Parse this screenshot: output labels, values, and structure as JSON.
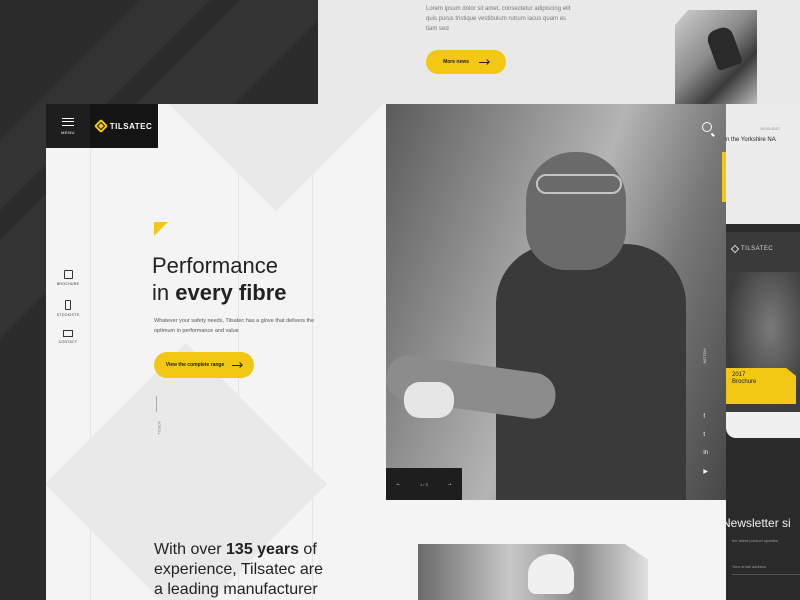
{
  "back_page": {
    "body_text": "Lorem ipsum dolor sit amet, consectetur adipiscing elit quis purus tristique vestibulum rutrum iacus quam es tiam sed",
    "button_label": "More news"
  },
  "side_news": {
    "date": "19.03.2017",
    "title": "n the Yorkshire NA"
  },
  "side_mobile": {
    "logo": "TILSATEC",
    "brochure_year": "2017",
    "brochure_label": "Brochure"
  },
  "newsletter": {
    "title": "Newsletter si",
    "subtitle": "the latest product updates",
    "email_placeholder": "Your email address"
  },
  "header": {
    "menu_label": "MENU",
    "logo_text": "TILSATEC"
  },
  "sidenav": {
    "items": [
      {
        "label": "BROCHURE",
        "icon": "book-icon"
      },
      {
        "label": "STOCKISTS",
        "icon": "phone-icon"
      },
      {
        "label": "CONTACT",
        "icon": "mail-icon"
      }
    ]
  },
  "scroll_label": "SCROLL",
  "hero": {
    "headline_line1": "Performance",
    "headline_line2_prefix": "in ",
    "headline_line2_bold": "every fibre",
    "lead": "Whatever your safety needs, Tilsatec has a glove that delivers the optimum in performance and value",
    "cta_label": "View the complete range",
    "slide_counter": "1 / 3",
    "follow_label": "FOLLOW",
    "social": [
      "f",
      "t",
      "in",
      "▶"
    ]
  },
  "intro": {
    "line1_prefix": "With over ",
    "line1_bold": "135 years",
    "line1_suffix": " of",
    "line2": "experience, Tilsatec are",
    "line3": "a leading manufacturer"
  },
  "colors": {
    "accent": "#f2c814",
    "dark": "#1e1e1e",
    "background": "#2b2b2b"
  }
}
